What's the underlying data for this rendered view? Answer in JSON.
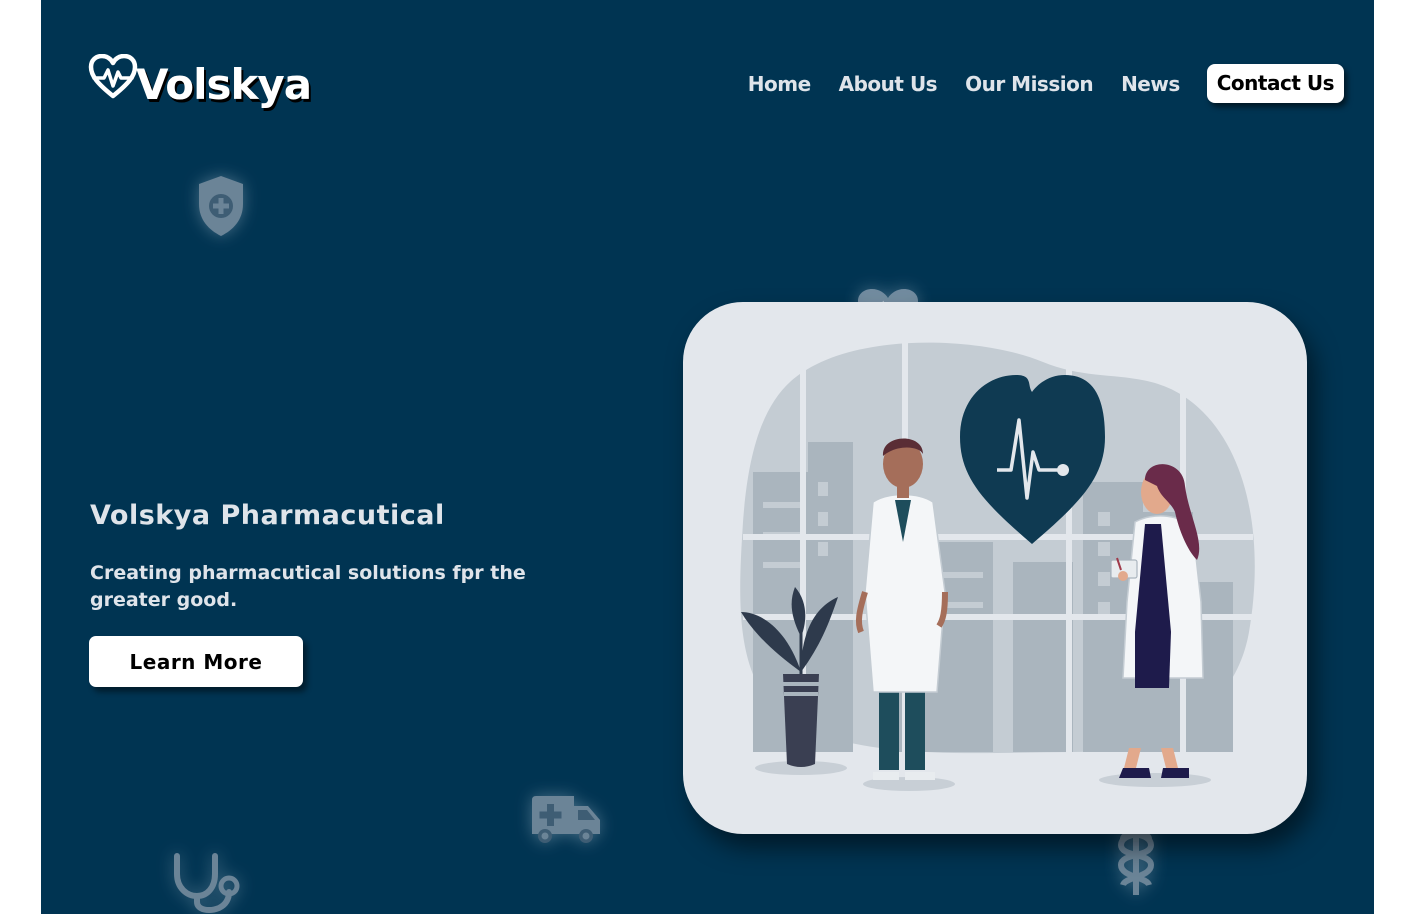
{
  "brand": {
    "name": "Volskya",
    "logo_icon": "heartbeat-heart-icon"
  },
  "nav": {
    "items": [
      {
        "label": "Home"
      },
      {
        "label": "About Us"
      },
      {
        "label": "Our Mission"
      },
      {
        "label": "News"
      }
    ],
    "contact_label": "Contact Us"
  },
  "hero": {
    "title": "Volskya Pharmacutical",
    "subtitle": "Creating pharmacutical solutions fpr the greater good.",
    "cta_label": "Learn More"
  },
  "decor_icons": [
    "shield-plus-icon",
    "heartbeat-heart-icon",
    "ambulance-icon",
    "stethoscope-icon",
    "caduceus-icon"
  ],
  "illustration": {
    "icon": "doctors-heartbeat-illustration"
  },
  "colors": {
    "background": "#003452",
    "text_light": "#dfe4ea",
    "button_bg": "#ffffff",
    "card_bg": "#e3e7ec",
    "heart": "#0f3a52"
  }
}
